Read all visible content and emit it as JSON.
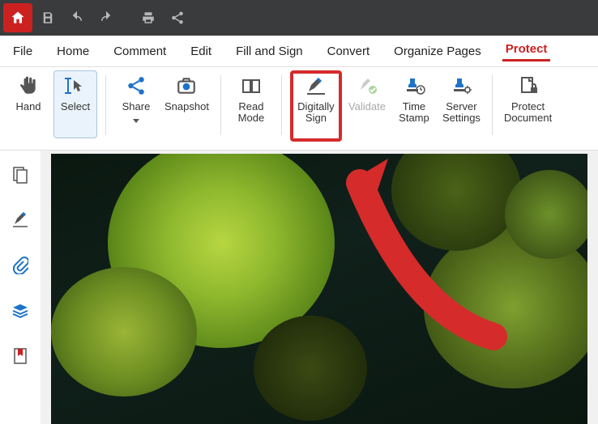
{
  "titlebar": {
    "buttons": [
      "home",
      "save",
      "undo",
      "redo",
      "print",
      "share"
    ]
  },
  "tabs": [
    {
      "label": "File",
      "active": false
    },
    {
      "label": "Home",
      "active": false
    },
    {
      "label": "Comment",
      "active": false
    },
    {
      "label": "Edit",
      "active": false
    },
    {
      "label": "Fill and Sign",
      "active": false
    },
    {
      "label": "Convert",
      "active": false
    },
    {
      "label": "Organize Pages",
      "active": false
    },
    {
      "label": "Protect",
      "active": true
    }
  ],
  "ribbon": [
    {
      "label": "Hand",
      "lines": "Hand"
    },
    {
      "label": "Select",
      "lines": "Select"
    },
    {
      "label": "Share",
      "lines": "Share"
    },
    {
      "label": "Snapshot",
      "lines": "Snapshot"
    },
    {
      "label": "Read Mode",
      "lines": "Read\nMode"
    },
    {
      "label": "Digitally Sign",
      "lines": "Digitally\nSign"
    },
    {
      "label": "Validate",
      "lines": "Validate"
    },
    {
      "label": "Time Stamp",
      "lines": "Time\nStamp"
    },
    {
      "label": "Server Settings",
      "lines": "Server\nSettings"
    },
    {
      "label": "Protect Document",
      "lines": "Protect\nDocument"
    }
  ],
  "sidebar": [
    "pages",
    "sign",
    "attachments",
    "layers",
    "bookmarks"
  ],
  "colors": {
    "accent": "#cc2121",
    "highlight": "#d52b2b",
    "selected": "#eaf3fb",
    "iconBlue": "#1e73c9"
  },
  "annotations": {
    "highlighted_button": "Digitally Sign",
    "arrow_direction": "pointing up-left to Digitally Sign"
  }
}
